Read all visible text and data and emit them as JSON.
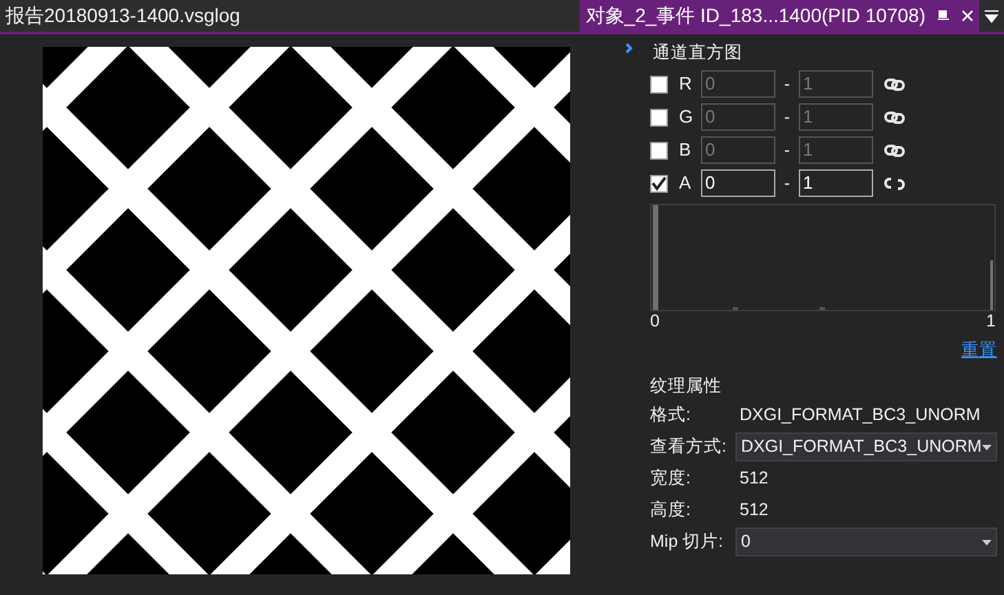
{
  "tabs": [
    {
      "label": "报告20180913-1400.vsglog",
      "selected": false
    },
    {
      "label": "对象_2_事件 ID_183...1400(PID 10708)",
      "selected": true
    }
  ],
  "histogram": {
    "title": "通道直方图",
    "channels": [
      {
        "label": "R",
        "checked": false,
        "disabled": true,
        "linked": true,
        "min": "0",
        "separator": "-",
        "max": "1"
      },
      {
        "label": "G",
        "checked": false,
        "disabled": true,
        "linked": true,
        "min": "0",
        "separator": "-",
        "max": "1"
      },
      {
        "label": "B",
        "checked": false,
        "disabled": true,
        "linked": true,
        "min": "0",
        "separator": "-",
        "max": "1"
      },
      {
        "label": "A",
        "checked": true,
        "disabled": false,
        "linked": false,
        "min": "0",
        "separator": "-",
        "max": "1"
      }
    ],
    "axis_min": "0",
    "axis_max": "1",
    "reset_link": "重置"
  },
  "properties": {
    "title": "纹理属性",
    "rows": [
      {
        "kind": "text",
        "label": "格式:",
        "value": "DXGI_FORMAT_BC3_UNORM"
      },
      {
        "kind": "dropdown",
        "label": "查看方式:",
        "value": "DXGI_FORMAT_BC3_UNORM"
      },
      {
        "kind": "text",
        "label": "宽度:",
        "value": "512"
      },
      {
        "kind": "text",
        "label": "高度:",
        "value": "512"
      },
      {
        "kind": "dropdown",
        "label": "Mip 切片:",
        "value": "0"
      }
    ]
  }
}
